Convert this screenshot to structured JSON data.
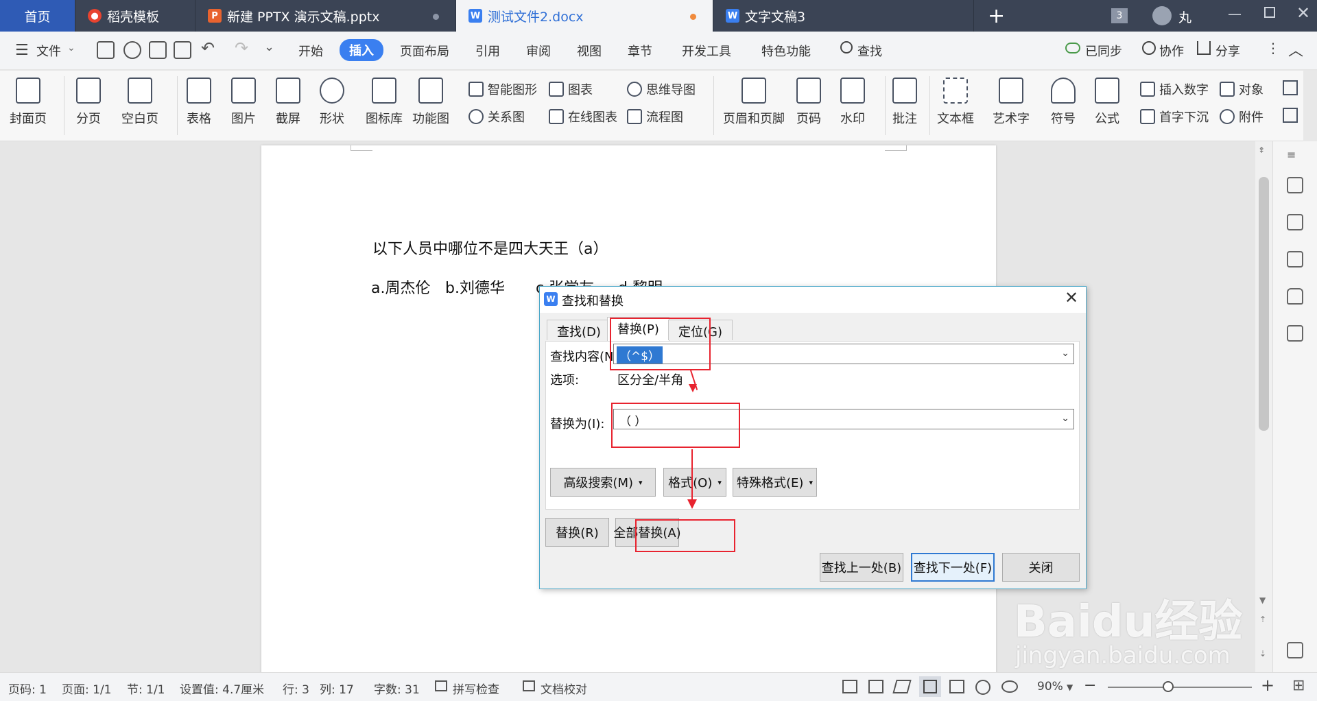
{
  "tabs": [
    {
      "label": "首页",
      "icon": "home-tab"
    },
    {
      "label": "稻壳模板",
      "icon": "docer-icon"
    },
    {
      "label": "新建 PPTX 演示文稿.pptx",
      "icon": "pptx-icon"
    },
    {
      "label": "测试文件2.docx",
      "icon": "docx-icon"
    },
    {
      "label": "文字文稿3",
      "icon": "docx-icon"
    }
  ],
  "window": {
    "count_badge": "3",
    "user_name": "丸"
  },
  "menu": {
    "file": "文件",
    "items": [
      "开始",
      "插入",
      "页面布局",
      "引用",
      "审阅",
      "视图",
      "章节",
      "开发工具",
      "特色功能"
    ],
    "active": "插入",
    "search": "查找",
    "sync": "已同步",
    "collab": "协作",
    "share": "分享"
  },
  "ribbon": {
    "cover": "封面页",
    "page_break": "分页",
    "blank_page": "空白页",
    "table": "表格",
    "picture": "图片",
    "screenshot": "截屏",
    "shape": "形状",
    "icon_lib": "图标库",
    "function_chart": "功能图",
    "smart_shape": "智能图形",
    "chart": "图表",
    "mind_map": "思维导图",
    "relation": "关系图",
    "online_chart": "在线图表",
    "flowchart": "流程图",
    "header_footer": "页眉和页脚",
    "page_number": "页码",
    "watermark": "水印",
    "comment": "批注",
    "textbox": "文本框",
    "wordart": "艺术字",
    "symbol": "符号",
    "formula": "公式",
    "insert_number": "插入数字",
    "object": "对象",
    "drop_cap": "首字下沉",
    "attachment": "附件"
  },
  "document": {
    "line1": "以下人员中哪位不是四大天王（a）",
    "line2_a": "a.周杰伦",
    "line2_b": "b.刘德华",
    "line2_c": "c.张学友",
    "line2_d": "d.黎明"
  },
  "dialog": {
    "title": "查找和替换",
    "tab_find": "查找(D)",
    "tab_replace": "替换(P)",
    "tab_goto": "定位(G)",
    "find_label": "查找内容(N):",
    "find_value": "（^$）",
    "options_label": "选项:",
    "options_value": "区分全/半角",
    "replace_label": "替换为(I):",
    "replace_value": "（ ）",
    "advanced": "高级搜索(M)",
    "format": "格式(O)",
    "special": "特殊格式(E)",
    "replace_btn": "替换(R)",
    "replace_all": "全部替换(A)",
    "find_prev": "查找上一处(B)",
    "find_next": "查找下一处(F)",
    "close": "关闭"
  },
  "status": {
    "page_no": "页码: 1",
    "pages": "页面: 1/1",
    "section": "节: 1/1",
    "setting": "设置值: 4.7厘米",
    "row": "行: 3",
    "col": "列: 17",
    "words": "字数: 31",
    "spell": "拼写检查",
    "proof": "文档校对",
    "zoom": "90%"
  },
  "watermark": {
    "brand": "Baidu经验",
    "url": "jingyan.baidu.com"
  },
  "colors": {
    "accent": "#3a7ff0",
    "annotation": "#e8232f",
    "tabbar": "#3b4455"
  }
}
